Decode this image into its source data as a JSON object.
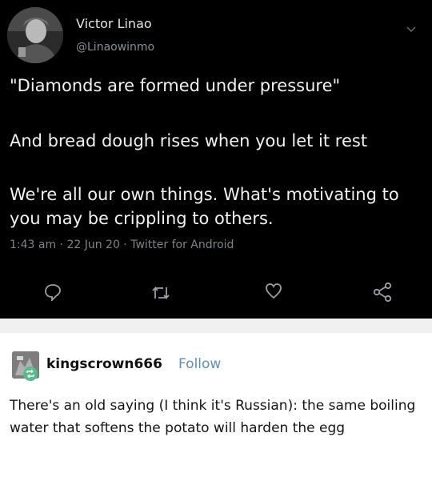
{
  "tweet": {
    "author_name": "Victor Linao",
    "author_handle": "@Linaowinmo",
    "lines": [
      "\"Diamonds are formed under pressure\"",
      "And bread dough rises when you let it rest",
      "We're all our own things. What's motivating to you may be crippling to others."
    ],
    "meta": "1:43 am · 22 Jun 20 · Twitter for Android",
    "icons": [
      "reply-icon",
      "retweet-icon",
      "like-icon",
      "share-icon"
    ]
  },
  "tumblr": {
    "username": "kingscrown666",
    "follow_label": "Follow",
    "text": "There's an old saying (I think it's Russian): the same boiling water that softens the potato will harden the egg",
    "colors": {
      "follow": "#5a8fb8",
      "reblog_badge": "#56bc8a"
    }
  }
}
